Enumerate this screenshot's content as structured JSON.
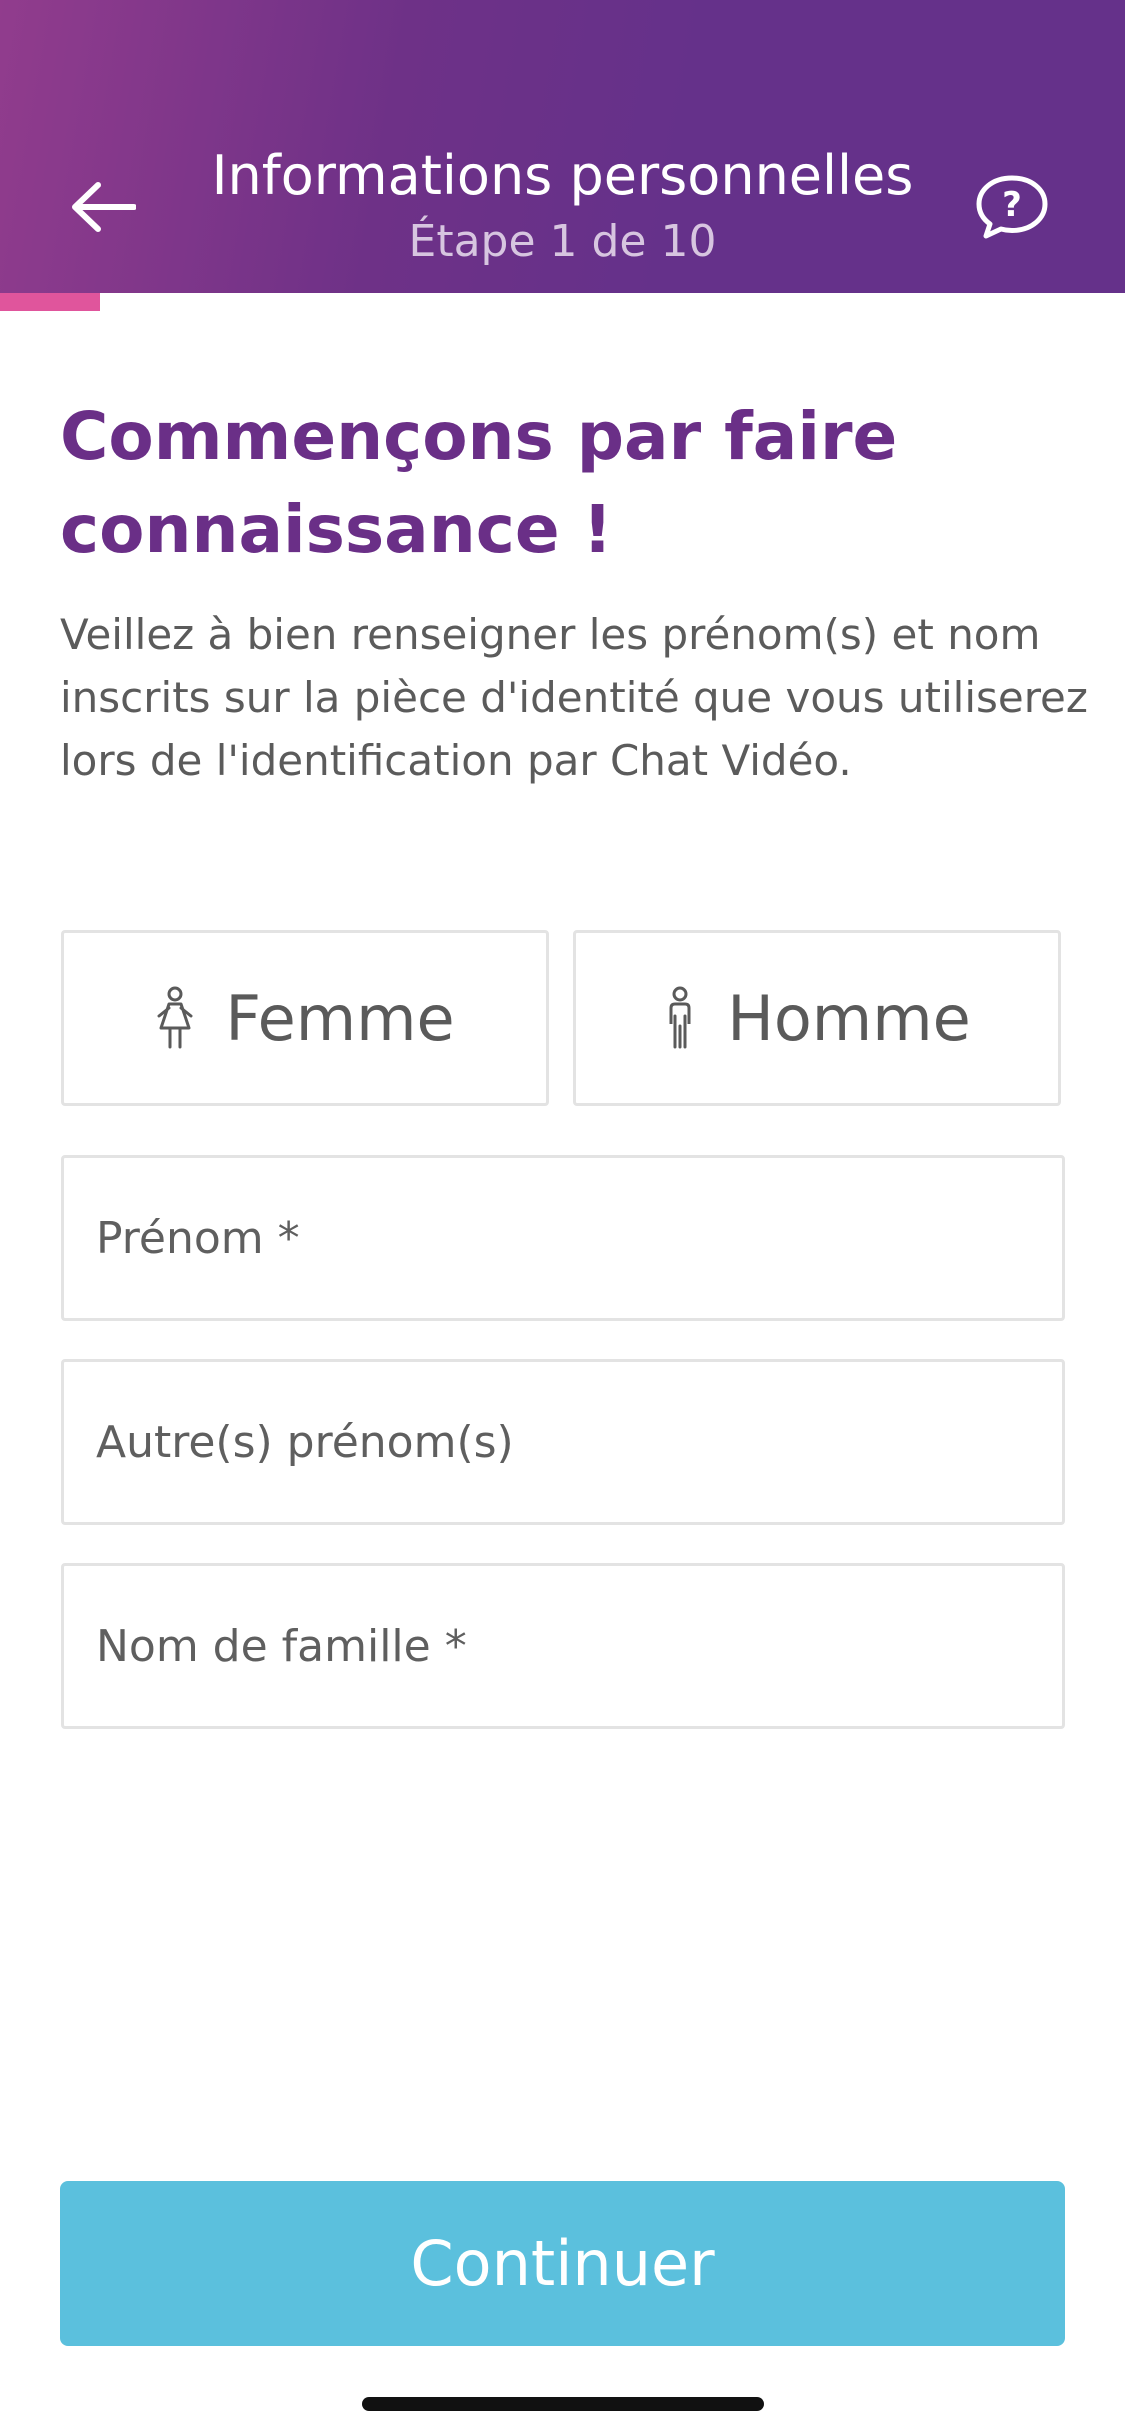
{
  "header": {
    "title": "Informations personnelles",
    "step": "Étape 1 de 10",
    "back_icon": "arrow-left-icon",
    "help_icon": "help-chat-bubble-icon",
    "progress": 0.1,
    "progress_color": "#e0559c"
  },
  "content": {
    "heading": "Commençons par faire connaissance !",
    "intro": "Veillez à bien renseigner les prénom(s) et nom inscrits sur la pièce d'identité que vous utiliserez lors de l'identification par Chat Vidéo."
  },
  "gender": {
    "female_label": "Femme",
    "female_icon": "female-person-icon",
    "male_label": "Homme",
    "male_icon": "male-person-icon"
  },
  "form": {
    "first_name_placeholder": "Prénom *",
    "first_name_value": "",
    "other_names_placeholder": "Autre(s) prénom(s)",
    "other_names_value": "",
    "last_name_placeholder": "Nom de famille *",
    "last_name_value": ""
  },
  "actions": {
    "continue_label": "Continuer",
    "continue_color": "#5bc0dd"
  },
  "colors": {
    "brand_purple": "#65318a",
    "heading_purple": "#6a2f87"
  }
}
